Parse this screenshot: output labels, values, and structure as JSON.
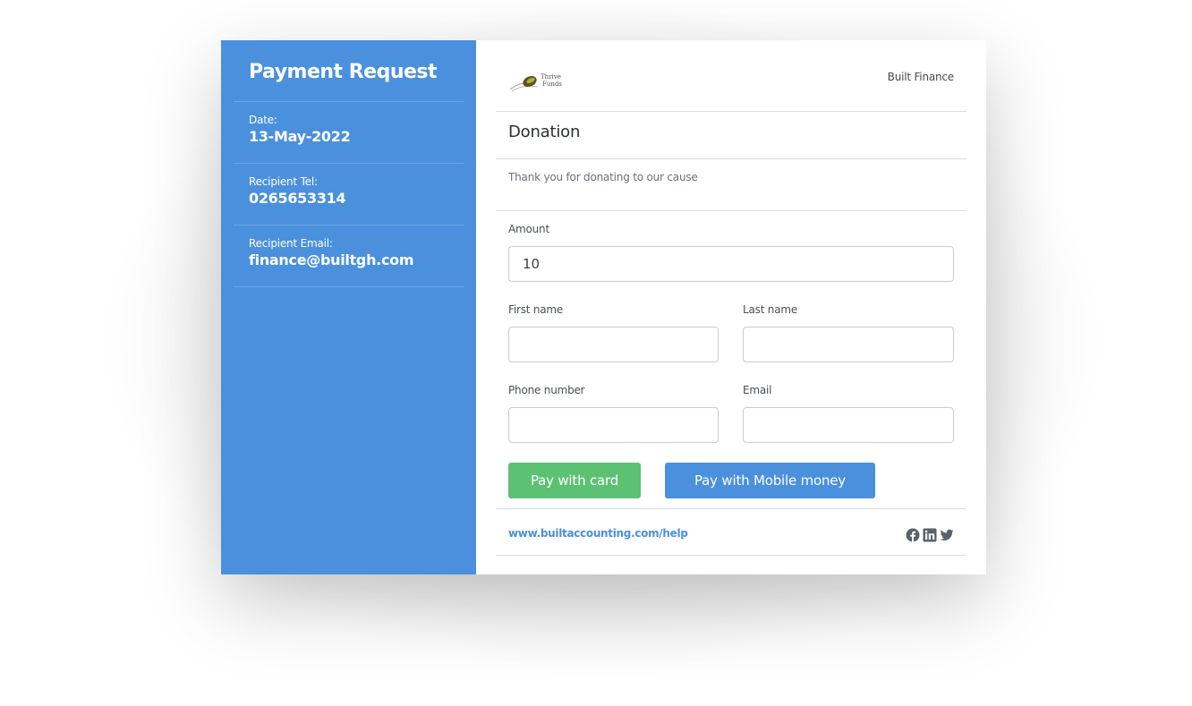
{
  "sidebar": {
    "title": "Payment Request",
    "items": [
      {
        "label": "Date:",
        "value": "13-May-2022"
      },
      {
        "label": "Recipient Tel:",
        "value": "0265653314"
      },
      {
        "label": "Recipient Email:",
        "value": "finance@builtgh.com"
      }
    ]
  },
  "header": {
    "logo_text_line1": "Thrive",
    "logo_text_line2": "Funds",
    "company": "Built Finance"
  },
  "form": {
    "title": "Donation",
    "description": "Thank you for donating to our cause",
    "amount_label": "Amount",
    "amount_value": "10",
    "first_name_label": "First name",
    "first_name_value": "",
    "last_name_label": "Last name",
    "last_name_value": "",
    "phone_label": "Phone number",
    "phone_value": "",
    "email_label": "Email",
    "email_value": ""
  },
  "actions": {
    "pay_card": "Pay with card",
    "pay_mobile": "Pay with Mobile money"
  },
  "footer": {
    "help_link": "www.builtaccounting.com/help",
    "social_icons": [
      "facebook-icon",
      "linkedin-icon",
      "twitter-icon"
    ]
  },
  "colors": {
    "primary": "#4a90dd",
    "success": "#5cc173"
  }
}
